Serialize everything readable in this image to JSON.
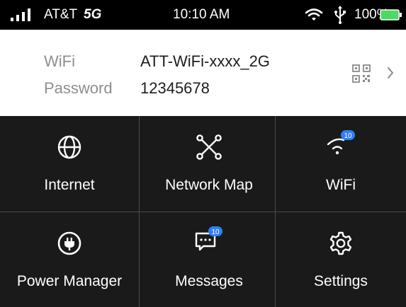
{
  "status": {
    "carrier": "AT&T",
    "network": "5G",
    "time": "10:10 AM",
    "battery": "100%",
    "battery_color": "#4cd964",
    "icons": [
      "signal-bars-icon",
      "wifi-icon",
      "usb-icon",
      "battery-icon"
    ]
  },
  "wifi": {
    "ssid_label": "WiFi",
    "ssid": "ATT-WiFi-xxxx_2G",
    "password_label": "Password",
    "password": "12345678",
    "icons": [
      "qr-code-icon",
      "chevron-right-icon"
    ]
  },
  "tiles": [
    {
      "label": "Internet",
      "icon": "globe-icon"
    },
    {
      "label": "Network Map",
      "icon": "network-map-icon"
    },
    {
      "label": "WiFi",
      "icon": "wifi-icon",
      "badge": "10"
    },
    {
      "label": "Power Manager",
      "icon": "power-plug-icon"
    },
    {
      "label": "Messages",
      "icon": "message-icon",
      "badge": "10"
    },
    {
      "label": "Settings",
      "icon": "gear-icon"
    }
  ],
  "badge_color": "#2f7ff7"
}
